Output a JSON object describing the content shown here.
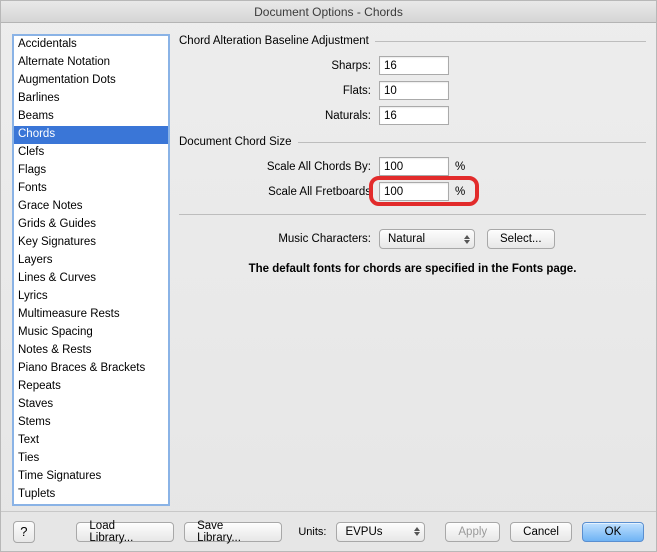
{
  "title": "Document Options - Chords",
  "sidebar": {
    "items": [
      {
        "label": "Accidentals"
      },
      {
        "label": "Alternate Notation"
      },
      {
        "label": "Augmentation Dots"
      },
      {
        "label": "Barlines"
      },
      {
        "label": "Beams"
      },
      {
        "label": "Chords",
        "selected": true
      },
      {
        "label": "Clefs"
      },
      {
        "label": "Flags"
      },
      {
        "label": "Fonts"
      },
      {
        "label": "Grace Notes"
      },
      {
        "label": "Grids & Guides"
      },
      {
        "label": "Key Signatures"
      },
      {
        "label": "Layers"
      },
      {
        "label": "Lines & Curves"
      },
      {
        "label": "Lyrics"
      },
      {
        "label": "Multimeasure Rests"
      },
      {
        "label": "Music Spacing"
      },
      {
        "label": "Notes & Rests"
      },
      {
        "label": "Piano Braces & Brackets"
      },
      {
        "label": "Repeats"
      },
      {
        "label": "Staves"
      },
      {
        "label": "Stems"
      },
      {
        "label": "Text"
      },
      {
        "label": "Ties"
      },
      {
        "label": "Time Signatures"
      },
      {
        "label": "Tuplets"
      }
    ]
  },
  "groups": {
    "baseline": {
      "title": "Chord Alteration Baseline Adjustment",
      "sharps_label": "Sharps:",
      "sharps_value": "16",
      "flats_label": "Flats:",
      "flats_value": "10",
      "naturals_label": "Naturals:",
      "naturals_value": "16"
    },
    "chordsize": {
      "title": "Document Chord Size",
      "scale_chords_label": "Scale All Chords By:",
      "scale_chords_value": "100",
      "scale_fretboards_label": "Scale All Fretboards",
      "scale_fretboards_value": "100",
      "pct": "%"
    }
  },
  "music_characters": {
    "label": "Music Characters:",
    "value": "Natural",
    "select_button": "Select..."
  },
  "help_text": "The default fonts for chords are specified in the Fonts page.",
  "footer": {
    "help": "?",
    "load_library": "Load Library...",
    "save_library": "Save Library...",
    "units_label": "Units:",
    "units_value": "EVPUs",
    "apply": "Apply",
    "cancel": "Cancel",
    "ok": "OK"
  }
}
